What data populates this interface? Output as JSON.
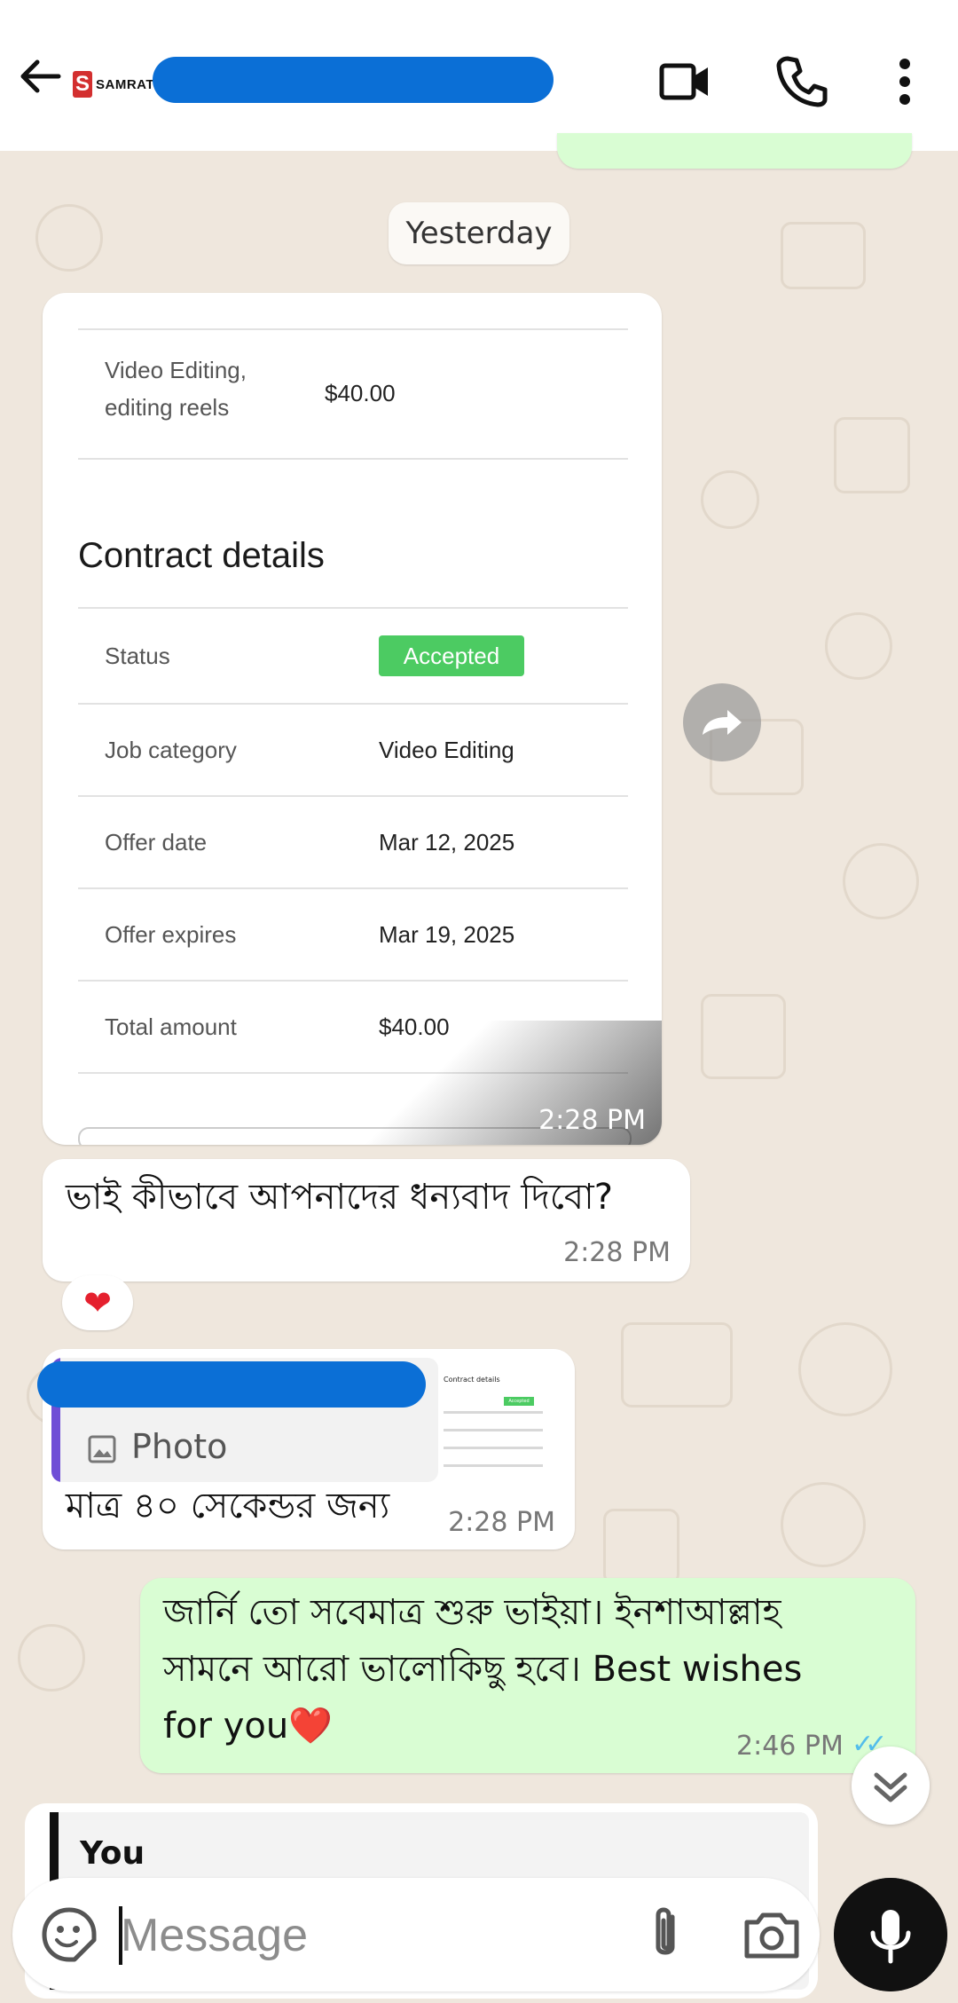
{
  "header": {
    "logo_text": "SAMRAT",
    "logo_mark": "S",
    "back_icon": "arrow-left-icon",
    "video_icon": "video-camera-icon",
    "call_icon": "phone-icon",
    "menu_icon": "kebab-menu-icon"
  },
  "date_divider": "Yesterday",
  "contract_card": {
    "service_label": "Video Editing,\nediting reels",
    "service_line1": "Video Editing,",
    "service_line2": "editing reels",
    "service_amount": "$40.00",
    "section_title": "Contract details",
    "rows": [
      {
        "label": "Status",
        "value": "Accepted"
      },
      {
        "label": "Job category",
        "value": "Video Editing"
      },
      {
        "label": "Offer date",
        "value": "Mar 12, 2025"
      },
      {
        "label": "Offer expires",
        "value": "Mar 19, 2025"
      },
      {
        "label": "Total amount",
        "value": "$40.00"
      }
    ],
    "time": "2:28 PM"
  },
  "messages": [
    {
      "direction": "in",
      "text": "ভাই কীভাবে আপনাদের ধন্যবাদ দিবো?",
      "time": "2:28 PM",
      "reaction": "❤"
    },
    {
      "direction": "in",
      "quote_type": "Photo",
      "text": "মাত্র ৪০ সেকেন্ডর জন্য",
      "time": "2:28 PM",
      "thumb_title": "Contract details",
      "thumb_status": "Accepted"
    },
    {
      "direction": "out",
      "line1": "জার্নি তো সবেমাত্র শুরু ভাইয়া। ইনশাআল্লাহ",
      "line2": "সামনে আরো ভালোকিছু হবে। Best wishes",
      "line3": "for you",
      "emoji": "❤️",
      "time": "2:46 PM",
      "ticks": "✓✓"
    }
  ],
  "reply_preview": {
    "who": "You"
  },
  "composer": {
    "placeholder": "Message",
    "emoji_icon": "sticker-smile-icon",
    "attach_icon": "paperclip-icon",
    "camera_icon": "camera-icon",
    "mic_icon": "microphone-icon"
  },
  "colors": {
    "outgoing": "#d9fdd3",
    "incoming": "#ffffff",
    "accepted": "#4ccb62",
    "tick_read": "#53bdeb",
    "redaction": "#0b6fd6"
  }
}
